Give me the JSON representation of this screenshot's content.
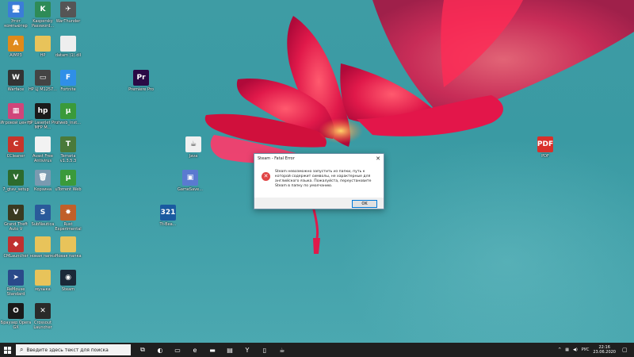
{
  "desktop": {
    "icons": [
      {
        "label": "Этот компьютер",
        "name": "this-pc-icon",
        "glyph": "🖥",
        "color": "#3b7dd8"
      },
      {
        "label": "Kaspersky Password...",
        "name": "kaspersky-icon",
        "glyph": "K",
        "color": "#2e8b57"
      },
      {
        "label": "WarThunder",
        "name": "warthunder-icon",
        "glyph": "✈",
        "color": "#555555"
      },
      {
        "label": "AIMP3",
        "name": "aimp-icon",
        "glyph": "A",
        "color": "#e08a1a"
      },
      {
        "label": "HP",
        "name": "folder-hp-icon",
        "glyph": "",
        "color": "#e8c35a"
      },
      {
        "label": "datam (1).dll",
        "name": "dll-file-icon",
        "glyph": "",
        "color": "#eeeeee"
      },
      {
        "label": "Warface",
        "name": "warface-icon",
        "glyph": "W",
        "color": "#333333"
      },
      {
        "label": "HP LJ M1257...",
        "name": "hp-printer-icon",
        "glyph": "▭",
        "color": "#444444"
      },
      {
        "label": "Fortnite",
        "name": "fortnite-icon",
        "glyph": "F",
        "color": "#2f8fe8"
      },
      {
        "label": "Premiere Pro",
        "name": "premiere-icon",
        "glyph": "Pr",
        "color": "#2a0a45"
      },
      {
        "label": "Игровой центр",
        "name": "game-center-icon",
        "glyph": "▦",
        "color": "#d0457a"
      },
      {
        "label": "HP LaserJet Pro MFP M...",
        "name": "hp-laserjet-icon",
        "glyph": "hp",
        "color": "#1a1a1a"
      },
      {
        "label": "utweb_inst...",
        "name": "utweb-icon",
        "glyph": "µ",
        "color": "#3a9a3a"
      },
      {
        "label": "CCleaner",
        "name": "ccleaner-icon",
        "glyph": "C",
        "color": "#c8342a"
      },
      {
        "label": "Avast Free Antivirus",
        "name": "avast-file-icon",
        "glyph": "",
        "color": "#f2f2f2"
      },
      {
        "label": "Terraria v1.3.5.3",
        "name": "terraria-icon",
        "glyph": "T",
        "color": "#4a7a3a"
      },
      {
        "label": "Java",
        "name": "java-icon",
        "glyph": "☕",
        "color": "#f0f0f0"
      },
      {
        "label": "PDF",
        "name": "pdf-icon",
        "glyph": "PDF",
        "color": "#d9302a"
      },
      {
        "label": "7_gtav_setup",
        "name": "gtav-setup-icon",
        "glyph": "V",
        "color": "#2d6b2d"
      },
      {
        "label": "Корзина",
        "name": "recycle-bin-icon",
        "glyph": "🗑",
        "color": "#7a9ab0"
      },
      {
        "label": "uTorrent Web",
        "name": "utorrent-icon",
        "glyph": "µ",
        "color": "#3a9a3a"
      },
      {
        "label": "GameSave...",
        "name": "gamesave-icon",
        "glyph": "▣",
        "color": "#5a7ad0"
      },
      {
        "label": "Grand Theft Auto V",
        "name": "gta5-icon",
        "glyph": "V",
        "color": "#3a3a20"
      },
      {
        "label": "SubNautica",
        "name": "subnautica-icon",
        "glyph": "S",
        "color": "#2a5a9a"
      },
      {
        "label": "Rust Experimental",
        "name": "rust-icon",
        "glyph": "✸",
        "color": "#c0602a"
      },
      {
        "label": "Tt-Bea...",
        "name": "calendar-app-icon",
        "glyph": "321",
        "color": "#1a5aa0"
      },
      {
        "label": "CMLauncher",
        "name": "cmlauncher-icon",
        "glyph": "◆",
        "color": "#c03030"
      },
      {
        "label": "новая папка",
        "name": "new-folder-icon",
        "glyph": "",
        "color": "#e8c35a"
      },
      {
        "label": "Новая папка",
        "name": "new-folder-2-icon",
        "glyph": "",
        "color": "#e8c35a"
      },
      {
        "label": "ReMouse Standard",
        "name": "remouse-icon",
        "glyph": "➤",
        "color": "#2a4a8a"
      },
      {
        "label": "музыка",
        "name": "music-folder-icon",
        "glyph": "",
        "color": "#e8c35a"
      },
      {
        "label": "Steam",
        "name": "steam-icon",
        "glyph": "◉",
        "color": "#1b2838"
      },
      {
        "label": "Браузер Opera GX",
        "name": "opera-gx-icon",
        "glyph": "O",
        "color": "#1a1a1a"
      },
      {
        "label": "Crossout Launcher",
        "name": "crossout-icon",
        "glyph": "✕",
        "color": "#2a2a2a"
      }
    ]
  },
  "dialog": {
    "title": "Steam - Fatal Error",
    "close_glyph": "✕",
    "message": "Steam невозможно запустить из папки, путь к которой содержит символы, не характерные для английского языка. Пожалуйста, переустановите Steam в папку по умолчанию.",
    "ok_label": "OK"
  },
  "taskbar": {
    "search_placeholder": "Введите здесь текст для поиска",
    "pinned": [
      {
        "name": "task-view-icon",
        "glyph": "⧉"
      },
      {
        "name": "cortana-icon",
        "glyph": "◐"
      },
      {
        "name": "taskbar-app-icon",
        "glyph": "▭"
      },
      {
        "name": "edge-icon",
        "glyph": "e"
      },
      {
        "name": "file-explorer-icon",
        "glyph": "▬"
      },
      {
        "name": "store-icon",
        "glyph": "▤"
      },
      {
        "name": "yandex-browser-icon",
        "glyph": "Y"
      },
      {
        "name": "taskbar-doc-icon",
        "glyph": "▯"
      },
      {
        "name": "taskbar-java-icon",
        "glyph": "☕"
      }
    ],
    "tray": {
      "chevron": "^",
      "network": "▦",
      "volume": "◀)",
      "language": "РУС",
      "time": "22:16",
      "date": "23.06.2020",
      "notifications": "▢"
    }
  }
}
